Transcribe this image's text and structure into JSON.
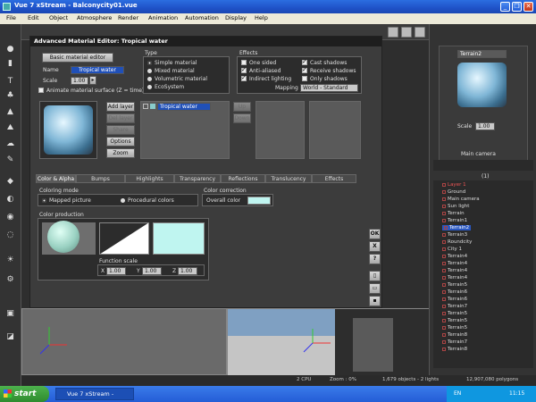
{
  "window": {
    "title": "Vue 7 xStream - Balconycity01.vue"
  },
  "menu": [
    "File",
    "Edit",
    "Object",
    "Atmosphere",
    "Render",
    "Animation",
    "Automation",
    "Display",
    "Help"
  ],
  "dialog": {
    "title": "Advanced Material Editor: Tropical water",
    "basic_editor_label": "Basic material editor",
    "name_label": "Name",
    "name_value": "Tropical water",
    "scale_label": "Scale",
    "scale_value": "1.00",
    "animate_label": "Animate material surface (Z = time)",
    "type_header": "Type",
    "types": [
      "Simple material",
      "Mixed material",
      "Volumetric material",
      "EcoSystem"
    ],
    "effects_header": "Effects",
    "effects_left": [
      "One sided",
      "Anti-aliased",
      "Indirect lighting"
    ],
    "effects_right": [
      "Cast shadows",
      "Receive shadows",
      "Only shadows"
    ],
    "mapping_label": "Mapping",
    "mapping_value": "World - Standard",
    "layer_buttons": [
      "Add layer",
      "Del layer",
      "Share",
      "Options",
      "Zoom"
    ],
    "layer_item": "Tropical water",
    "updown": [
      "Up",
      "Down"
    ],
    "tabs": [
      "Color & Alpha",
      "Bumps",
      "Highlights",
      "Transparency",
      "Reflections",
      "Translucency",
      "Effects"
    ],
    "coloring_mode_label": "Coloring mode",
    "coloring_modes": [
      "Mapped picture",
      "Procedural colors"
    ],
    "color_correction_label": "Color correction",
    "overall_color_label": "Overall color",
    "overall_color": "#bff5f0",
    "color_production_label": "Color production",
    "function_scale_label": "Function scale",
    "fs_x_label": "X",
    "fs_x": "1.00",
    "fs_y_label": "Y",
    "fs_y": "1.00",
    "fs_z_label": "Z",
    "fs_z": "1.00",
    "side_buttons": [
      "OK",
      "X",
      "?"
    ]
  },
  "right_panel": {
    "terrain_tab": "Terrain2",
    "scale_label": "Scale",
    "scale_value": "1.00",
    "camera_label": "Main camera",
    "layer_count": "(1)",
    "tree": [
      "Layer 1",
      "Ground",
      "Main camera",
      "Sun light",
      "Terrain",
      "Terrain1",
      "Terrain2",
      "Terrain3",
      "Roundcity",
      "City 1",
      "Terrain4",
      "Terrain4",
      "Terrain4",
      "Terrain4",
      "Terrain5",
      "Terrain6",
      "Terrain6",
      "Terrain7",
      "Terrain5",
      "Terrain5",
      "Terrain5",
      "Terrain8",
      "Terrain7",
      "Terrain8"
    ]
  },
  "status": {
    "cpu": "2 CPU",
    "zoom": "Zoom : 0%",
    "objects": "1,679 objects - 2 lights",
    "polygons": "12,907,080 polygons"
  },
  "taskbar": {
    "start": "start",
    "task": "Vue 7 xStream - Balc...",
    "lang": "EN",
    "time": "11:15"
  }
}
